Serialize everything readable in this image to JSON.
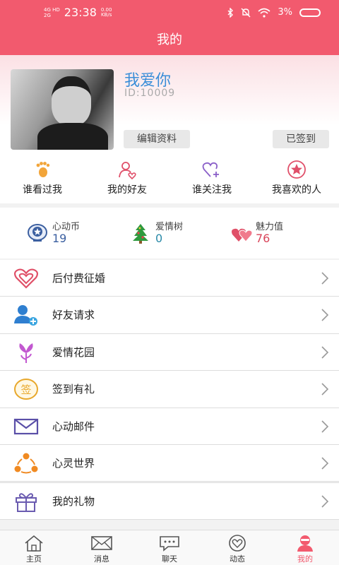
{
  "status_bar": {
    "network": "4G HD",
    "network2": "2G",
    "time": "23:38",
    "speed_value": "0.00",
    "speed_unit": "KB/s",
    "battery": "3%"
  },
  "header": {
    "title": "我的"
  },
  "profile": {
    "nickname": "我爱你",
    "user_id": "ID:10009",
    "edit_label": "编辑资料",
    "signed_label": "已签到"
  },
  "quick_links": [
    {
      "label": "谁看过我",
      "icon": "footprint-icon"
    },
    {
      "label": "我的好友",
      "icon": "friend-heart-icon"
    },
    {
      "label": "谁关注我",
      "icon": "heart-plus-icon"
    },
    {
      "label": "我喜欢的人",
      "icon": "star-badge-icon"
    }
  ],
  "stats": [
    {
      "name": "心动币",
      "value": "19",
      "icon": "coin-star-icon",
      "color": "#3b5fa0"
    },
    {
      "name": "爱情树",
      "value": "0",
      "icon": "love-tree-icon",
      "color": "#2a8aa8"
    },
    {
      "name": "魅力值",
      "value": "76",
      "icon": "hearts-icon",
      "color": "#d9455a"
    }
  ],
  "menu": [
    {
      "label": "后付费征婚",
      "icon": "double-heart-icon"
    },
    {
      "label": "好友请求",
      "icon": "add-user-icon"
    },
    {
      "label": "爱情花园",
      "icon": "flower-icon"
    },
    {
      "label": "签到有礼",
      "icon": "checkin-badge-icon"
    },
    {
      "label": "心动邮件",
      "icon": "mail-icon"
    },
    {
      "label": "心灵世界",
      "icon": "community-icon"
    }
  ],
  "menu_secondary": [
    {
      "label": "我的礼物",
      "icon": "gift-icon"
    }
  ],
  "tabs": [
    {
      "label": "主页",
      "icon": "home-icon"
    },
    {
      "label": "消息",
      "icon": "envelope-icon"
    },
    {
      "label": "聊天",
      "icon": "chat-icon"
    },
    {
      "label": "动态",
      "icon": "moments-icon"
    },
    {
      "label": "我的",
      "icon": "profile-icon",
      "active": true
    }
  ],
  "colors": {
    "brand": "#f25a6e",
    "link": "#3a8ed8"
  }
}
